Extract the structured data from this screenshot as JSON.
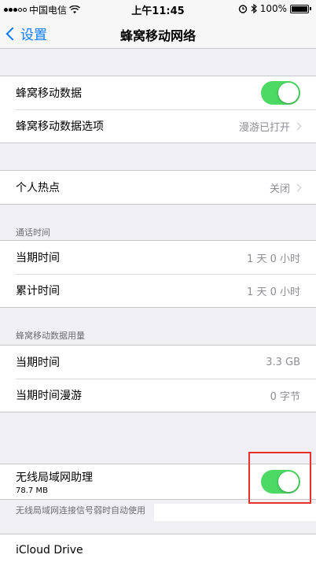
{
  "status_bar": {
    "carrier": "中国电信",
    "wifi_icon": "wifi-icon",
    "time": "上午11:45",
    "battery": "100%"
  },
  "nav": {
    "back_label": "设置",
    "title": "蜂窝移动网络"
  },
  "group1": {
    "cellular_data_label": "蜂窝移动数据",
    "cellular_data_on": true,
    "options_label": "蜂窝移动数据选项",
    "options_value": "漫游已打开"
  },
  "group2": {
    "hotspot_label": "个人热点",
    "hotspot_value": "关闭"
  },
  "call_time": {
    "header": "通话时间",
    "current_label": "当期时间",
    "current_value": "1 天 0 小时",
    "total_label": "累计时间",
    "total_value": "1 天 0 小时"
  },
  "data_usage": {
    "header": "蜂窝移动数据用量",
    "current_label": "当期时间",
    "current_value": "3.3 GB",
    "roaming_label": "当期时间漫游",
    "roaming_value": "0 字节"
  },
  "wifi_assist": {
    "label": "无线局域网助理",
    "size": "78.7 MB",
    "on": true,
    "note": "无线局域网连接信号弱时自动使用"
  },
  "icloud": {
    "label": "iCloud Drive"
  },
  "colors": {
    "accent": "#0a7aff",
    "toggle_on": "#4cd964",
    "highlight": "#e8302a"
  }
}
